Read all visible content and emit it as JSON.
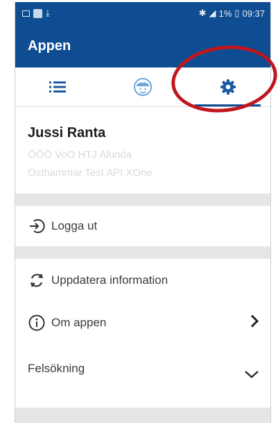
{
  "statusbar": {
    "right_text": "1%",
    "time": "09:37"
  },
  "appbar": {
    "title": "Appen"
  },
  "tabs": [
    {
      "icon": "list-icon",
      "active": false
    },
    {
      "icon": "nurse-icon",
      "active": false
    },
    {
      "icon": "gear-icon",
      "active": true
    }
  ],
  "user": {
    "name": "Jussi Ranta",
    "org": "ÖÖÖ VoO HTJ Alunda",
    "api": "Östhammar Test API XOne"
  },
  "menu": {
    "logout_label": "Logga ut",
    "update_label": "Uppdatera information",
    "about_label": "Om appen",
    "troubleshoot_label": "Felsökning"
  },
  "colors": {
    "primary": "#0f4d92",
    "annotation": "#c0161e",
    "divider": "#e6e6e6"
  }
}
